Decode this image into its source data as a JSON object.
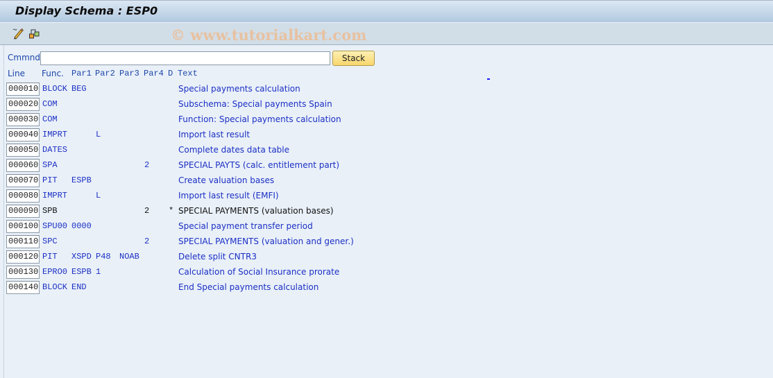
{
  "window": {
    "title": "Display Schema : ESP0",
    "watermark": "© www.tutorialkart.com"
  },
  "toolbar": {
    "icons": [
      {
        "name": "display-change-icon",
        "label": "Display <-> Change"
      },
      {
        "name": "hierarchy-icon",
        "label": "Other object"
      }
    ]
  },
  "command": {
    "label": "Cmmnd",
    "value": "",
    "placeholder": "",
    "stack_label": "Stack"
  },
  "table": {
    "headers": {
      "line": "Line",
      "func": "Func.",
      "par1": "Par1",
      "par2": "Par2",
      "par3": "Par3",
      "par4": "Par4",
      "d": "D",
      "text": "Text"
    },
    "rows": [
      {
        "line": "000010",
        "func": "BLOCK",
        "par1": "BEG",
        "par2": "",
        "par3": "",
        "par4": "",
        "d": "",
        "text": "Special payments calculation",
        "active": true
      },
      {
        "line": "000020",
        "func": "COM",
        "par1": "",
        "par2": "",
        "par3": "",
        "par4": "",
        "d": "",
        "text": "Subschema: Special payments Spain",
        "active": true
      },
      {
        "line": "000030",
        "func": "COM",
        "par1": "",
        "par2": "",
        "par3": "",
        "par4": "",
        "d": "",
        "text": "Function: Special payments calculation",
        "active": true
      },
      {
        "line": "000040",
        "func": "IMPRT",
        "par1": "",
        "par2": "L",
        "par3": "",
        "par4": "",
        "d": "",
        "text": "Import last result",
        "active": true
      },
      {
        "line": "000050",
        "func": "DATES",
        "par1": "",
        "par2": "",
        "par3": "",
        "par4": "",
        "d": "",
        "text": "Complete dates data table",
        "active": true
      },
      {
        "line": "000060",
        "func": "SPA",
        "par1": "",
        "par2": "",
        "par3": "",
        "par4": "2",
        "d": "",
        "text": "SPECIAL PAYTS (calc. entitlement part)",
        "active": true
      },
      {
        "line": "000070",
        "func": "PIT",
        "par1": "ESPB",
        "par2": "",
        "par3": "",
        "par4": "",
        "d": "",
        "text": "Create valuation bases",
        "active": true
      },
      {
        "line": "000080",
        "func": "IMPRT",
        "par1": "",
        "par2": "L",
        "par3": "",
        "par4": "",
        "d": "",
        "text": "Import last result (EMFI)",
        "active": true
      },
      {
        "line": "000090",
        "func": "SPB",
        "par1": "",
        "par2": "",
        "par3": "",
        "par4": "2",
        "d": "*",
        "text": "SPECIAL PAYMENTS (valuation bases)",
        "active": false
      },
      {
        "line": "000100",
        "func": "SPU00",
        "par1": "0000",
        "par2": "",
        "par3": "",
        "par4": "",
        "d": "",
        "text": "Special payment transfer period",
        "active": true
      },
      {
        "line": "000110",
        "func": "SPC",
        "par1": "",
        "par2": "",
        "par3": "",
        "par4": "2",
        "d": "",
        "text": "SPECIAL PAYMENTS (valuation and gener.)",
        "active": true
      },
      {
        "line": "000120",
        "func": "PIT",
        "par1": "XSPD",
        "par2": "P48",
        "par3": "NOAB",
        "par4": "",
        "d": "",
        "text": "Delete split CNTR3",
        "active": true
      },
      {
        "line": "000130",
        "func": "EPRO0",
        "par1": "ESPB",
        "par2": "1",
        "par3": "",
        "par4": "",
        "d": "",
        "text": "Calculation of Social Insurance prorate",
        "active": true
      },
      {
        "line": "000140",
        "func": "BLOCK",
        "par1": "END",
        "par2": "",
        "par3": "",
        "par4": "",
        "d": "",
        "text": "End Special payments calculation",
        "active": true
      }
    ]
  }
}
